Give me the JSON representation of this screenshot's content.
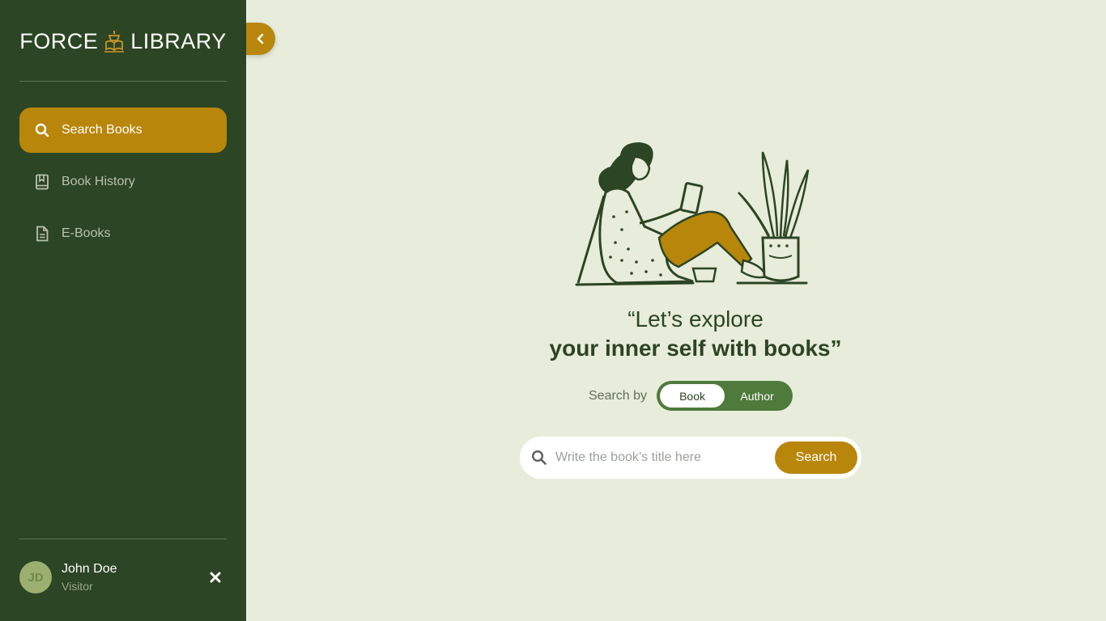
{
  "brand": {
    "left_text": "FORCE",
    "right_text": "LIBRARY"
  },
  "sidebar": {
    "items": [
      {
        "label": "Search Books",
        "icon": "search-icon",
        "active": true
      },
      {
        "label": "Book History",
        "icon": "book-bookmark-icon",
        "active": false
      },
      {
        "label": "E-Books",
        "icon": "document-icon",
        "active": false
      }
    ]
  },
  "user": {
    "initials": "JD",
    "name": "John Doe",
    "role": "Visitor"
  },
  "main": {
    "quote_line1": "“Let’s explore",
    "quote_line2": "your inner self with books”",
    "search_by_label": "Search by",
    "toggle_options": [
      "Book",
      "Author"
    ],
    "toggle_selected": "Book",
    "search_placeholder": "Write the book’s title here",
    "search_button": "Search"
  },
  "colors": {
    "sidebar_bg": "#2c4524",
    "accent": "#b8860b",
    "main_bg": "#e8ecdb",
    "toggle_bg": "#4e7a3c"
  }
}
